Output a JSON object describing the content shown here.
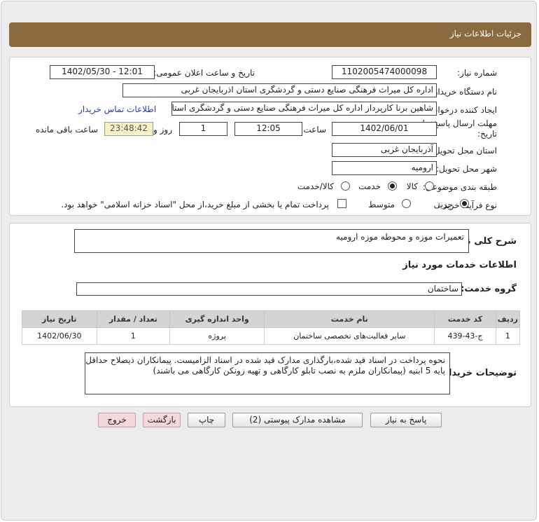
{
  "header": {
    "title": "جزئیات اطلاعات نیاز"
  },
  "need_info": {
    "need_number_label": "شماره نیاز:",
    "need_number": "1102005474000098",
    "announce_label": "تاریخ و ساعت اعلان عمومی:",
    "announce_value": "1402/05/30 - 12:01",
    "buyer_org_label": "نام دستگاه خریدار:",
    "buyer_org": "اداره کل میراث فرهنگی  صنایع دستی و گردشگری استان اذربایجان غربی",
    "requester_label": "ایجاد کننده درخواست:",
    "requester": "شاهین برنا کارپرداز اداره کل میراث فرهنگی  صنایع دستی و گردشگری استان اذربایجان غربی",
    "contact_link": "اطلاعات تماس خریدار",
    "deadline_label_1": "مهلت ارسال پاسخ: تا",
    "deadline_label_2": "تاریخ:",
    "deadline_date": "1402/06/01",
    "time_label": "ساعت",
    "deadline_time": "12:05",
    "days_value": "1",
    "days_label": "روز و",
    "remaining_time": "23:48:42",
    "remaining_label": "ساعت باقی مانده",
    "province_label": "استان محل تحویل:",
    "province": "آذربایجان غربی",
    "city_label": "شهر محل تحویل:",
    "city": "ارومیه",
    "category_label": "طبقه بندی موضوعی:",
    "category_options": [
      "کالا",
      "خدمت",
      "کالا/خدمت"
    ],
    "category_selected": "خدمت",
    "process_label": "نوع فرآیند خرید :",
    "process_options": [
      "جزیی",
      "متوسط"
    ],
    "process_selected": "جزیی",
    "payment_note": "پرداخت تمام یا بخشی از مبلغ خرید،از محل \"اسناد خزانه اسلامی\" خواهد بود."
  },
  "description": {
    "summary_label": "شرح کلی نیاز:",
    "summary": "تعمیرات موزه و محوطه موزه ارومیه",
    "services_title": "اطلاعات خدمات مورد نیاز",
    "service_group_label": "گروه خدمت:",
    "service_group": "ساختمان",
    "table": {
      "headers": [
        "ردیف",
        "کد خدمت",
        "نام خدمت",
        "واحد اندازه گیری",
        "تعداد / مقدار",
        "تاریخ نیاز"
      ],
      "rows": [
        [
          "1",
          "ج-43-439",
          "سایر فعالیت‌های تخصصی ساختمان",
          "پروژه",
          "1",
          "1402/06/30"
        ]
      ]
    },
    "buyer_notes_label": "توضیحات خریدار:",
    "buyer_notes_line1": "نحوه پرداخت در اسناد قید شده،بارگذاری مدارک قید شده در اسناد الزامیست. پیمانکاران ذیصلاح حداقل",
    "buyer_notes_line2": "پایه 5  ابنیه (پیمانکاران ملزم به نصب تابلو کارگاهی و تهیه زونکن کارگاهی می باشند)"
  },
  "buttons": {
    "reply": "پاسخ به نیاز",
    "attachments": "مشاهده مدارک پیوستی (2)",
    "print": "چاپ",
    "back": "بازگشت",
    "exit": "خروج"
  }
}
